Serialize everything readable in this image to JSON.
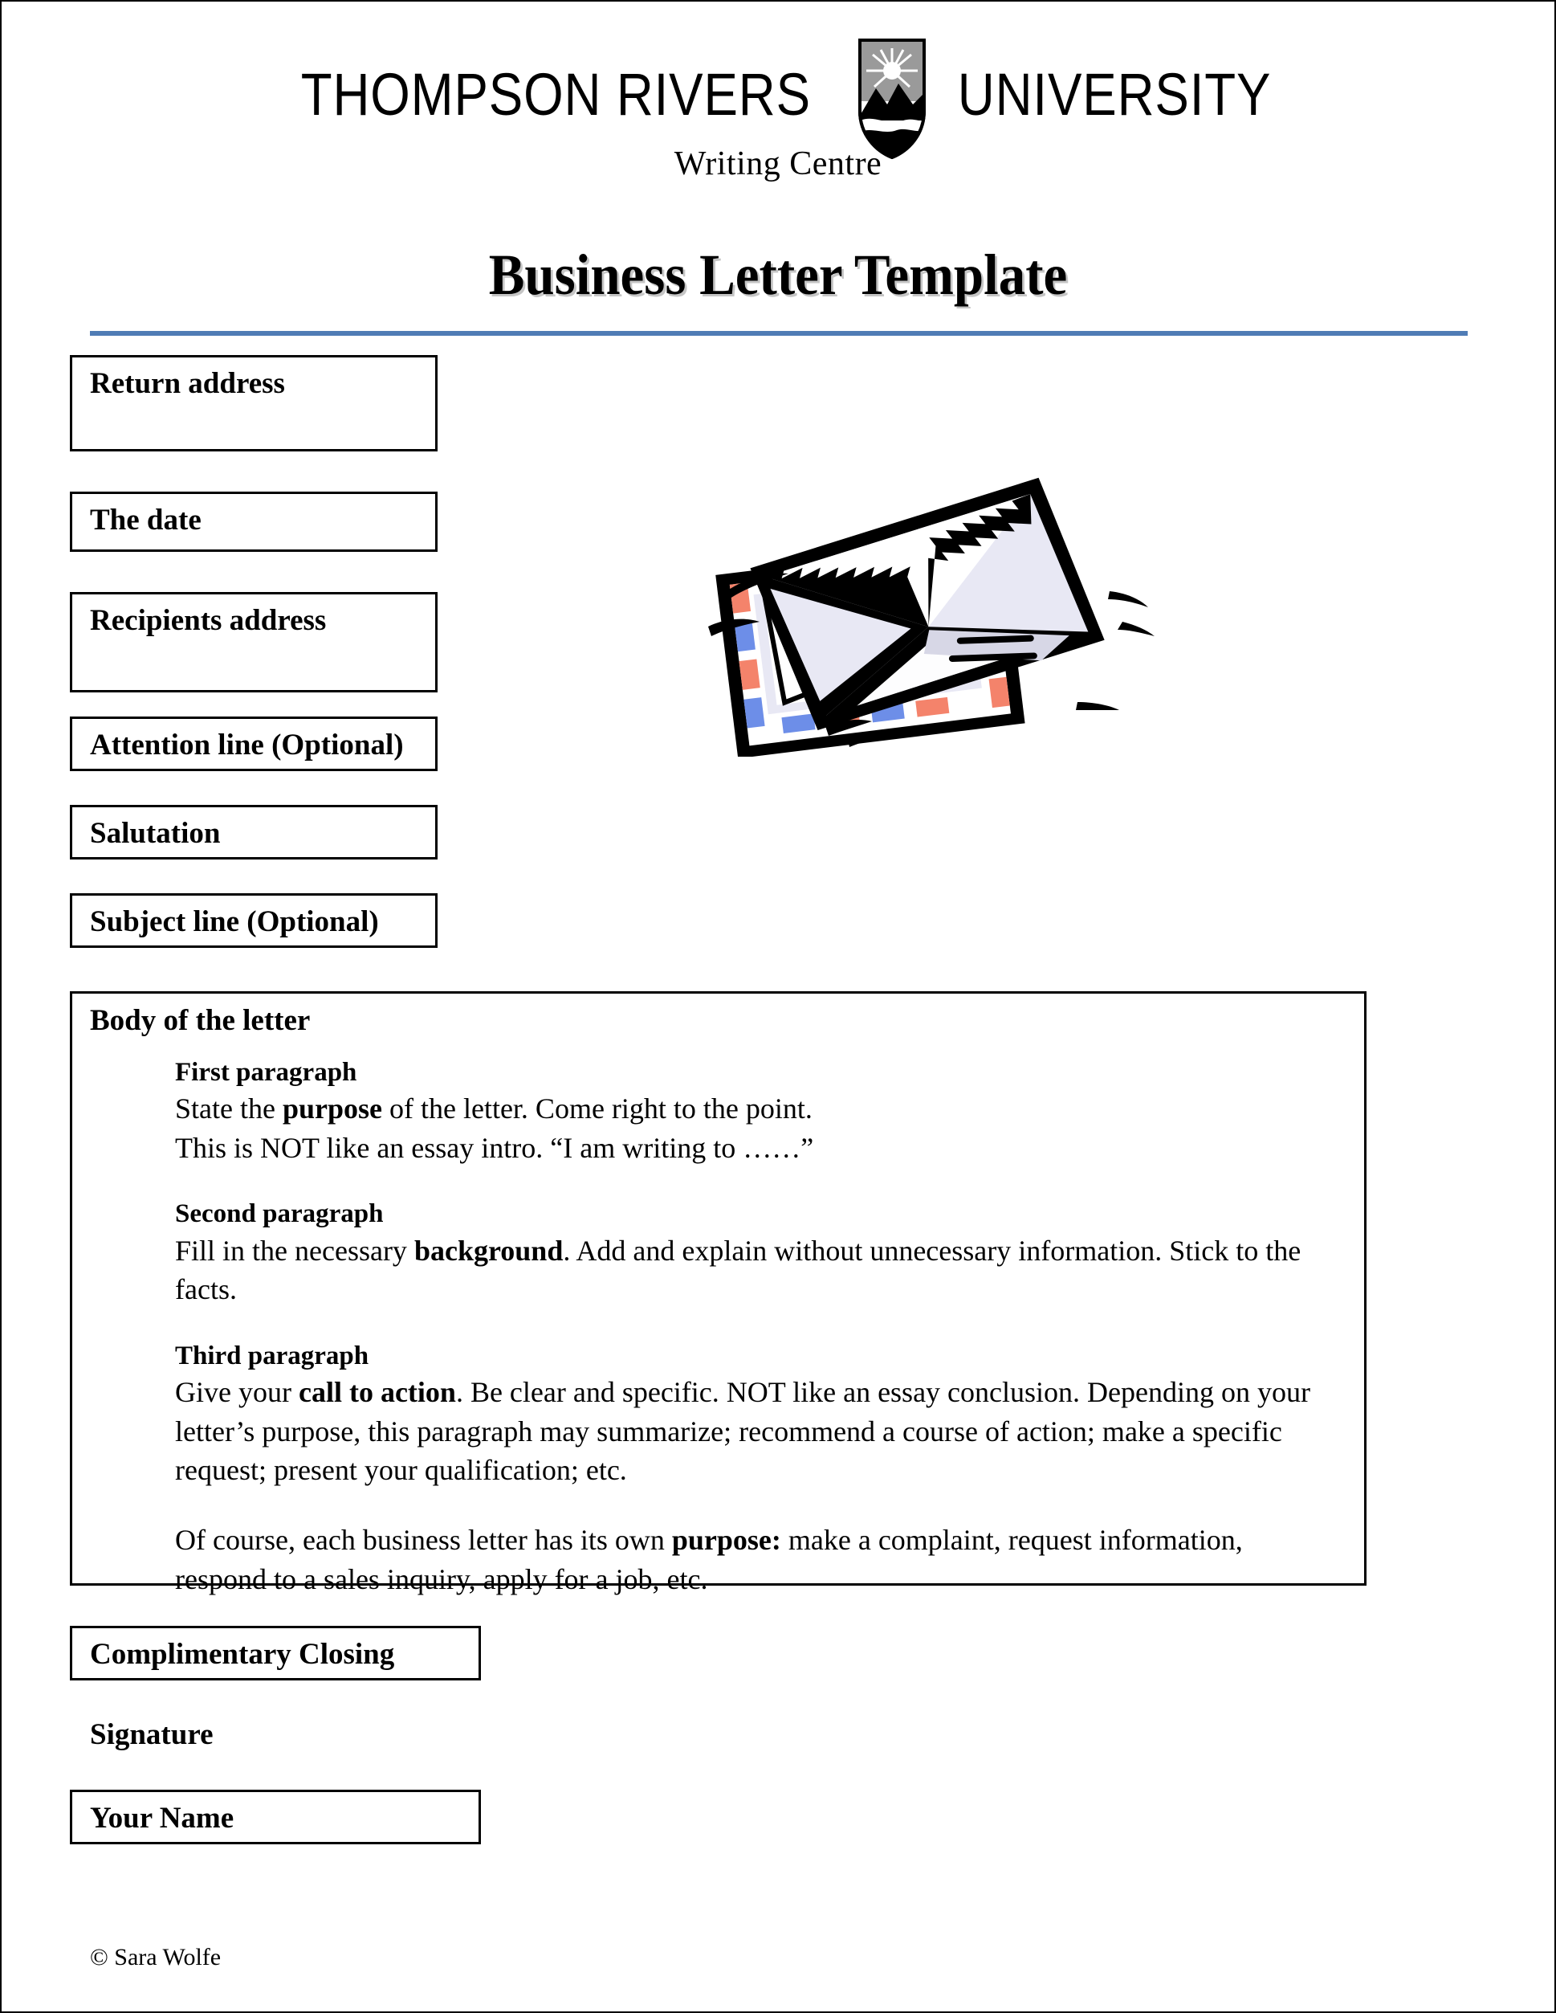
{
  "branding": {
    "university_name_part1": "THOMPSON RIVERS",
    "university_name_part2": "UNIVERSITY",
    "crest_alt": "tru-shield-crest",
    "department": "Writing Centre"
  },
  "document": {
    "title": "Business Letter Template",
    "rule_color": "#4f7cb5"
  },
  "clipart": {
    "name": "envelopes-airmail-clipart",
    "stripe_red": "#f4836b",
    "stripe_blue": "#6d8ee8",
    "paper_white": "#ffffff",
    "paper_shade": "#e8e8f4",
    "outline": "#000000"
  },
  "fields": [
    {
      "label": "Return address",
      "boxed": true
    },
    {
      "label": "The date",
      "boxed": true
    },
    {
      "label": "Recipients address",
      "boxed": true
    },
    {
      "label": "Attention line (Optional)",
      "boxed": true
    },
    {
      "label": "Salutation",
      "boxed": true
    },
    {
      "label": "Subject line (Optional)",
      "boxed": true
    }
  ],
  "body": {
    "heading": "Body of the letter",
    "paragraphs": [
      {
        "subheading": "First paragraph",
        "lines": [
          [
            {
              "t": "State the ",
              "b": false
            },
            {
              "t": "purpose",
              "b": true
            },
            {
              "t": " of the letter.  Come right to the point.",
              "b": false
            }
          ],
          [
            {
              "t": "This is NOT like an essay intro. “I am writing to ……”",
              "b": false
            }
          ]
        ]
      },
      {
        "subheading": "Second paragraph",
        "lines": [
          [
            {
              "t": "Fill in the necessary ",
              "b": false
            },
            {
              "t": "background",
              "b": true
            },
            {
              "t": ".  Add and explain without unnecessary information.  Stick to the facts.",
              "b": false
            }
          ]
        ]
      },
      {
        "subheading": "Third paragraph",
        "lines": [
          [
            {
              "t": "Give your ",
              "b": false
            },
            {
              "t": "call to action",
              "b": true
            },
            {
              "t": ".  Be clear and specific.  NOT like an essay conclusion.  Depending on your letter’s purpose, this paragraph may summarize; recommend a course of action; make a specific request; present your qualification; etc.",
              "b": false
            }
          ]
        ]
      },
      {
        "subheading": "",
        "lines": [
          [
            {
              "t": "Of course, each business letter has its own ",
              "b": false
            },
            {
              "t": "purpose:",
              "b": true
            },
            {
              "t": " make a complaint, request information, respond to a sales inquiry, apply for a job, etc.",
              "b": false
            }
          ]
        ]
      }
    ]
  },
  "closing": [
    {
      "label": "Complimentary Closing",
      "boxed": true
    },
    {
      "label": "Signature",
      "boxed": false
    },
    {
      "label": "Your Name",
      "boxed": true
    }
  ],
  "footer": {
    "copyright": "© Sara Wolfe"
  }
}
